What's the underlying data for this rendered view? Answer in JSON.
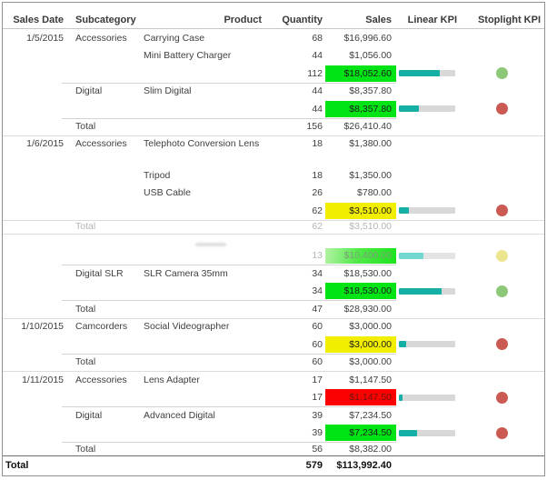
{
  "report": {
    "columns": [
      "Sales Date",
      "Subcategory",
      "Product",
      "Quantity",
      "Sales",
      "Linear KPI",
      "Stoplight KPI"
    ],
    "rows": [
      {
        "type": "detail",
        "date": "1/5/2015",
        "subcategory": "Accessories",
        "product": "Carrying Case",
        "quantity": "68",
        "sales": "$16,996.60"
      },
      {
        "type": "detail",
        "product": "Mini Battery Charger",
        "quantity": "44",
        "sales": "$1,056.00"
      },
      {
        "type": "kpi",
        "quantity": "112",
        "sales": "$18,052.60",
        "highlight": "green",
        "bar_pct": 73,
        "light": "green"
      },
      {
        "type": "detail",
        "subcategory": "Digital",
        "product": "Slim Digital",
        "quantity": "44",
        "sales": "$8,357.80",
        "line": "sub"
      },
      {
        "type": "kpi",
        "quantity": "44",
        "sales": "$8,357.80",
        "highlight": "green",
        "bar_pct": 35,
        "light": "red"
      },
      {
        "type": "total",
        "label": "Total",
        "quantity": "156",
        "sales": "$26,410.40",
        "line": "sub"
      },
      {
        "type": "detail",
        "date": "1/6/2015",
        "subcategory": "Accessories",
        "product": "Telephoto Conversion Lens",
        "quantity": "18",
        "sales": "$1,380.00",
        "line": "full",
        "tall": true
      },
      {
        "type": "detail",
        "product": "Tripod",
        "quantity": "18",
        "sales": "$1,350.00"
      },
      {
        "type": "detail",
        "product": "USB Cable",
        "quantity": "26",
        "sales": "$780.00"
      },
      {
        "type": "kpi",
        "quantity": "62",
        "sales": "$3,510.00",
        "highlight": "yellow",
        "bar_pct": 17,
        "light": "red"
      },
      {
        "type": "total",
        "label": "Total",
        "quantity": "62",
        "sales": "$3,510.00",
        "line": "full",
        "faded": true
      },
      {
        "type": "spacer",
        "line": "full"
      },
      {
        "type": "kpi",
        "quantity": "13",
        "sales": "$10,400.00",
        "highlight": "green-faded",
        "bar_pct": 43,
        "light": "yellow",
        "faded": true
      },
      {
        "type": "detail",
        "subcategory": "Digital SLR",
        "product": "SLR Camera 35mm",
        "quantity": "34",
        "sales": "$18,530.00",
        "line": "sub"
      },
      {
        "type": "kpi",
        "quantity": "34",
        "sales": "$18,530.00",
        "highlight": "green",
        "bar_pct": 76,
        "light": "green"
      },
      {
        "type": "total",
        "label": "Total",
        "quantity": "47",
        "sales": "$28,930.00",
        "line": "sub"
      },
      {
        "type": "detail",
        "date": "1/10/2015",
        "subcategory": "Camcorders",
        "product": "Social Videographer",
        "quantity": "60",
        "sales": "$3,000.00",
        "line": "full"
      },
      {
        "type": "kpi",
        "quantity": "60",
        "sales": "$3,000.00",
        "highlight": "yellow",
        "bar_pct": 13,
        "light": "red"
      },
      {
        "type": "total",
        "label": "Total",
        "quantity": "60",
        "sales": "$3,000.00",
        "line": "sub"
      },
      {
        "type": "detail",
        "date": "1/11/2015",
        "subcategory": "Accessories",
        "product": "Lens Adapter",
        "quantity": "17",
        "sales": "$1,147.50",
        "line": "full"
      },
      {
        "type": "kpi",
        "quantity": "17",
        "sales": "$1,147.50",
        "highlight": "red",
        "bar_pct": 6,
        "light": "red"
      },
      {
        "type": "detail",
        "subcategory": "Digital",
        "product": "Advanced Digital",
        "quantity": "39",
        "sales": "$7,234.50",
        "line": "sub"
      },
      {
        "type": "kpi",
        "quantity": "39",
        "sales": "$7,234.50",
        "highlight": "green",
        "bar_pct": 32,
        "light": "red"
      },
      {
        "type": "total",
        "label": "Total",
        "quantity": "56",
        "sales": "$8,382.00",
        "line": "sub"
      }
    ],
    "grand_total": {
      "label": "Total",
      "quantity": "579",
      "sales": "$113,992.40"
    }
  },
  "colors": {
    "highlights": {
      "green": {
        "bg": "#00e314",
        "fg": "#1c1c1c"
      },
      "yellow": {
        "bg": "#f2ee00",
        "fg": "#1c1c1c"
      },
      "red": {
        "bg": "#fb0200",
        "fg": "#701313"
      },
      "green-faded": {
        "bg": "linear-gradient(100deg,#b5f2a6,#53e94a 45%,#1ce31c)",
        "fg": "#7f9c7c"
      }
    },
    "bar_teal": "#14b0a6",
    "bar_teal_faded": "#72d8cf",
    "bar_track": "#d8d8d8",
    "bar_track_faded": "#e4e4e4",
    "lights": {
      "green": "#8cc878",
      "red": "#cb5a52",
      "yellow": "#e8e07c"
    }
  }
}
